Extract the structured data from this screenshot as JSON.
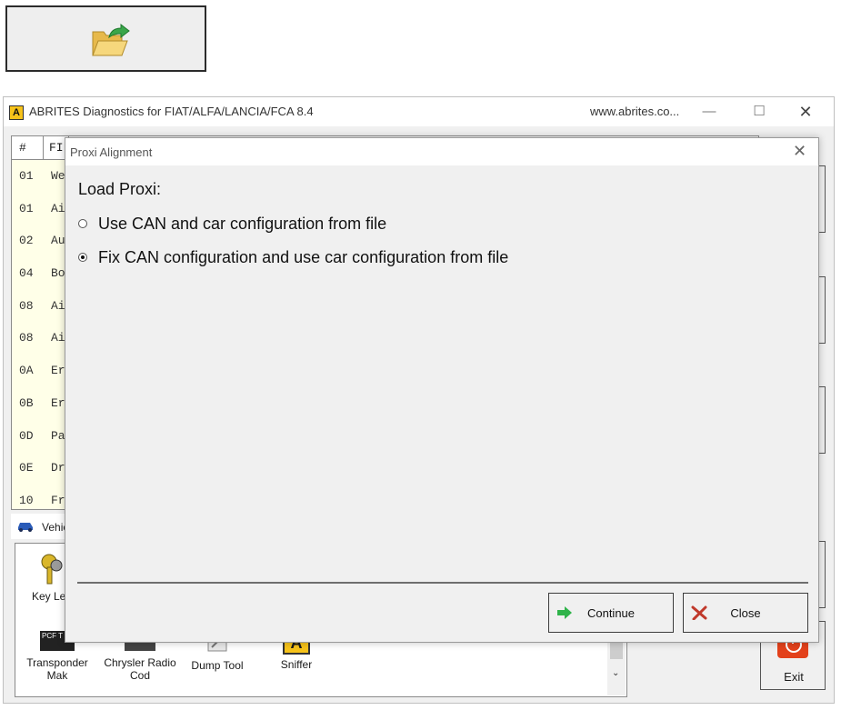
{
  "open_button": {
    "icon": "folder-open-icon"
  },
  "app": {
    "logo_letter": "A",
    "title": "ABRITES Diagnostics for FIAT/ALFA/LANCIA/FCA 8.4",
    "url": "www.abrites.co...",
    "minimize": "—",
    "maximize": "☐",
    "close": "✕"
  },
  "module_table": {
    "headers": [
      "#",
      "FI"
    ],
    "rows": [
      {
        "id": "01",
        "name": "We"
      },
      {
        "id": "01",
        "name": "Ai"
      },
      {
        "id": "02",
        "name": "Au"
      },
      {
        "id": "04",
        "name": "Bo"
      },
      {
        "id": "08",
        "name": "Ai"
      },
      {
        "id": "08",
        "name": "Ai"
      },
      {
        "id": "0A",
        "name": "Er"
      },
      {
        "id": "0B",
        "name": "Er"
      },
      {
        "id": "0D",
        "name": "Pa"
      },
      {
        "id": "0E",
        "name": "Dr"
      },
      {
        "id": "10",
        "name": "Fr"
      }
    ]
  },
  "vehicle_tab": {
    "label": "Vehic"
  },
  "tools": {
    "key_learning": "Key Lea",
    "transponder": "Transponder",
    "transponder_sub": "Mak",
    "chrysler": "Chrysler Radio",
    "chrysler_sub": "Cod",
    "dump_tool": "Dump Tool",
    "sniffer": "Sniffer",
    "pcf_badge": "PCF T"
  },
  "exit_button": {
    "label": "Exit"
  },
  "dialog": {
    "title": "Proxi Alignment",
    "close": "✕",
    "load_label": "Load Proxi:",
    "options": [
      {
        "label": "Use CAN and car configuration from file",
        "checked": false
      },
      {
        "label": "Fix CAN configuration and use car configuration from file",
        "checked": true
      }
    ],
    "continue_label": "Continue",
    "close_label": "Close"
  },
  "colors": {
    "continue_arrow": "#2fb34a",
    "close_x": "#c0392b",
    "table_bg": "#ffffe8",
    "logo_bg": "#f7c31a",
    "exit_red": "#e3411b"
  }
}
